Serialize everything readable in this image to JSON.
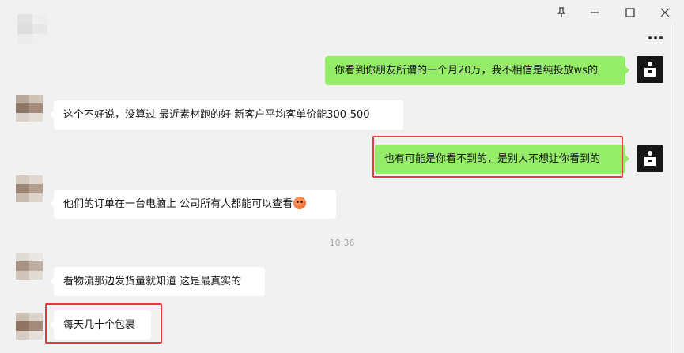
{
  "window": {
    "controls": {
      "pin_icon": "pin-icon",
      "minimize_icon": "minimize-icon",
      "maximize_icon": "maximize-icon",
      "close_icon": "close-icon"
    },
    "more_icon": "more-icon"
  },
  "colors": {
    "background": "#f1f1f1",
    "bubble_in": "#ffffff",
    "bubble_out": "#95ec69",
    "highlight": "#e6383d",
    "timestamp": "#a3a3a3"
  },
  "messages": [
    {
      "side": "out",
      "text": "你看到你朋友所谓的一个月20万，我不相信是纯投放ws的",
      "highlighted": false
    },
    {
      "side": "in",
      "text": "这个不好说，没算过 最近素材跑的好  新客户平均客单价能300-500",
      "highlighted": false
    },
    {
      "side": "out",
      "text": "也有可能是你看不到的，是别人不想让你看到的",
      "highlighted": true
    },
    {
      "side": "in",
      "text": "他们的订单在一台电脑上 公司所有人都能可以查看",
      "emoji": "emoji-face-icon",
      "highlighted": false
    },
    {
      "side": "in",
      "text": "看物流那边发货量就知道 这是最真实的",
      "highlighted": false
    },
    {
      "side": "in",
      "text": "每天几十个包裹",
      "highlighted": true
    }
  ],
  "timestamp": "10:36"
}
